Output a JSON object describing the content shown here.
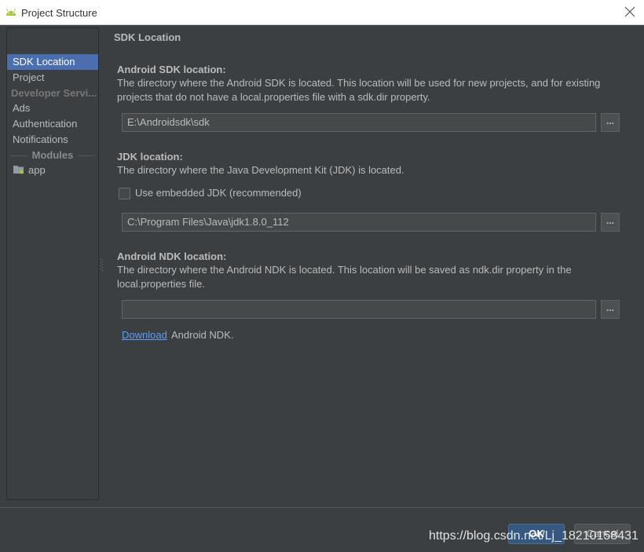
{
  "window": {
    "title": "Project Structure"
  },
  "sidebar": {
    "items": [
      {
        "label": "SDK Location",
        "selected": true
      },
      {
        "label": "Project"
      },
      {
        "label": "Developer Servi..."
      },
      {
        "label": "Ads"
      },
      {
        "label": "Authentication"
      },
      {
        "label": "Notifications"
      }
    ],
    "modules_header": "Modules",
    "module": "app"
  },
  "main": {
    "section_title": "SDK Location",
    "sdk": {
      "label": "Android SDK location:",
      "desc1": "The directory where the Android SDK is located. This location will be used for new projects, and for existing",
      "desc2": "projects that do not have a local.properties file with a sdk.dir property.",
      "value": "E:\\Androidsdk\\sdk",
      "browse": "..."
    },
    "jdk": {
      "label": "JDK location:",
      "desc": "The directory where the Java Development Kit (JDK) is located.",
      "checkbox_label": "Use embedded JDK (recommended)",
      "checked": false,
      "value": "C:\\Program Files\\Java\\jdk1.8.0_112",
      "browse": "..."
    },
    "ndk": {
      "label": "Android NDK location:",
      "desc1": "The directory where the Android NDK is located. This location will be saved as ndk.dir property in the",
      "desc2": "local.properties file.",
      "value": "",
      "browse": "...",
      "download_link": "Download",
      "download_rest": "Android NDK."
    }
  },
  "buttons": {
    "ok": "OK",
    "cancel": "Cancel"
  },
  "watermark": "https://blog.csdn.net/Lj_18210158431",
  "colors": {
    "accent": "#4b6eaf",
    "link": "#589df6",
    "add": "#59a869",
    "android": "#a4c639"
  }
}
